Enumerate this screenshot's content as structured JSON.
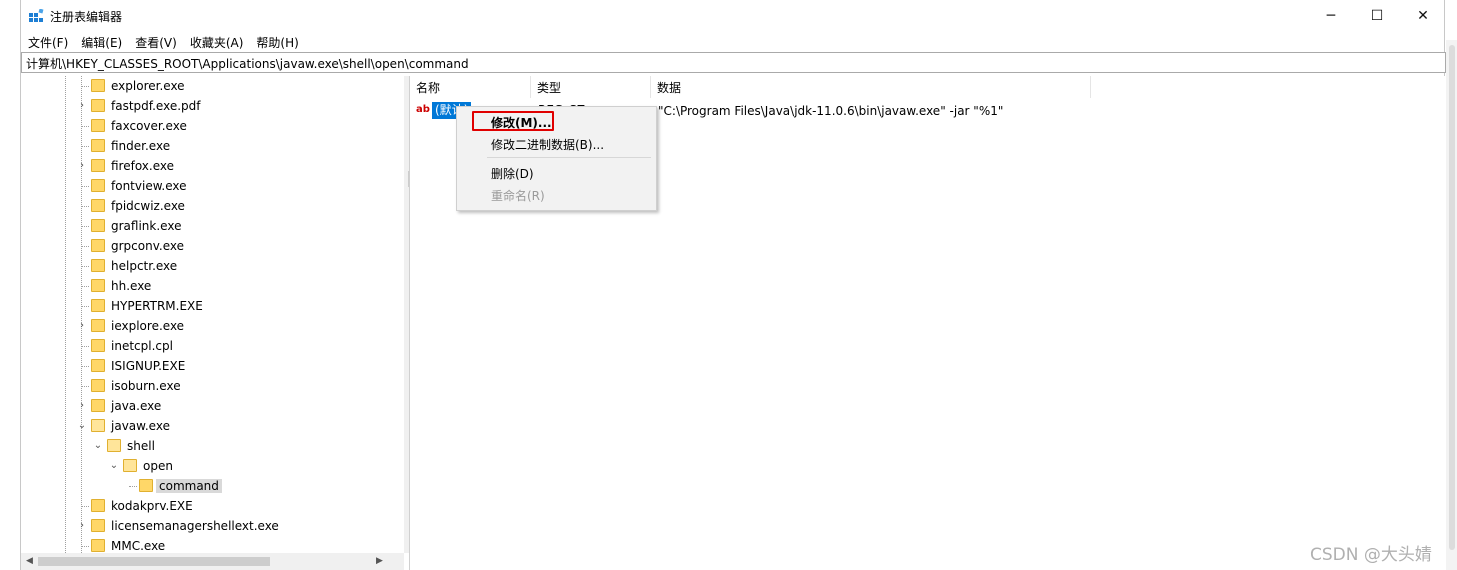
{
  "window": {
    "title": "注册表编辑器",
    "app_icon": "registry-icon",
    "controls": {
      "minimize": "─",
      "maximize": "☐",
      "close": "✕"
    }
  },
  "menu": [
    "文件(F)",
    "编辑(E)",
    "查看(V)",
    "收藏夹(A)",
    "帮助(H)"
  ],
  "address": "计算机\\HKEY_CLASSES_ROOT\\Applications\\javaw.exe\\shell\\open\\command",
  "tree": {
    "items": [
      {
        "label": "explorer.exe",
        "level": 0,
        "expander": ""
      },
      {
        "label": "fastpdf.exe.pdf",
        "level": 0,
        "expander": "›"
      },
      {
        "label": "faxcover.exe",
        "level": 0,
        "expander": ""
      },
      {
        "label": "finder.exe",
        "level": 0,
        "expander": ""
      },
      {
        "label": "firefox.exe",
        "level": 0,
        "expander": "›"
      },
      {
        "label": "fontview.exe",
        "level": 0,
        "expander": ""
      },
      {
        "label": "fpidcwiz.exe",
        "level": 0,
        "expander": ""
      },
      {
        "label": "graflink.exe",
        "level": 0,
        "expander": ""
      },
      {
        "label": "grpconv.exe",
        "level": 0,
        "expander": ""
      },
      {
        "label": "helpctr.exe",
        "level": 0,
        "expander": ""
      },
      {
        "label": "hh.exe",
        "level": 0,
        "expander": ""
      },
      {
        "label": "HYPERTRM.EXE",
        "level": 0,
        "expander": ""
      },
      {
        "label": "iexplore.exe",
        "level": 0,
        "expander": "›"
      },
      {
        "label": "inetcpl.cpl",
        "level": 0,
        "expander": ""
      },
      {
        "label": "ISIGNUP.EXE",
        "level": 0,
        "expander": ""
      },
      {
        "label": "isoburn.exe",
        "level": 0,
        "expander": ""
      },
      {
        "label": "java.exe",
        "level": 0,
        "expander": "›"
      },
      {
        "label": "javaw.exe",
        "level": 0,
        "expander": "⌄"
      },
      {
        "label": "shell",
        "level": 1,
        "expander": "⌄"
      },
      {
        "label": "open",
        "level": 2,
        "expander": "⌄"
      },
      {
        "label": "command",
        "level": 3,
        "expander": "",
        "selected": true
      },
      {
        "label": "kodakprv.EXE",
        "level": 0,
        "expander": ""
      },
      {
        "label": "licensemanagershellext.exe",
        "level": 0,
        "expander": "›"
      },
      {
        "label": "MMC.exe",
        "level": 0,
        "expander": ""
      }
    ]
  },
  "list": {
    "columns": [
      "名称",
      "类型",
      "数据"
    ],
    "rows": [
      {
        "icon": "ab",
        "name": "(默认)",
        "type": "REG_SZ",
        "data": "\"C:\\Program Files\\Java\\jdk-11.0.6\\bin\\javaw.exe\" -jar \"%1\""
      }
    ]
  },
  "context_menu": {
    "items": [
      {
        "label": "修改(M)...",
        "bold": true,
        "enabled": true
      },
      {
        "label": "修改二进制数据(B)...",
        "bold": false,
        "enabled": true
      },
      {
        "label": "删除(D)",
        "bold": false,
        "enabled": true
      },
      {
        "label": "重命名(R)",
        "bold": false,
        "enabled": false
      }
    ]
  },
  "watermark": "CSDN @大头婧",
  "colors": {
    "selection": "#0078d7",
    "highlight_box": "#e00000",
    "folder": "#ffd768"
  }
}
